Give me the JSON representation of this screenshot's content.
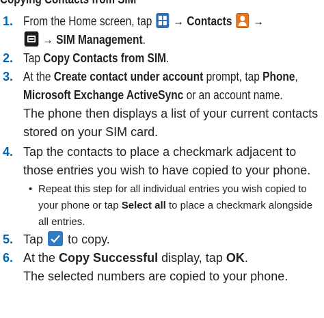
{
  "heading": "Copying Contacts from SIM",
  "steps": {
    "s1": {
      "num": "1.",
      "a": "From the Home screen, tap",
      "arrow1": "→",
      "contacts": "Contacts",
      "arrow2": "→",
      "arrow3": "→",
      "sim": "SIM Management",
      "end": "."
    },
    "s2": {
      "num": "2.",
      "a": "Tap",
      "b": "Copy Contacts from SIM",
      "end": "."
    },
    "s3": {
      "num": "3.",
      "a": "At the",
      "b": "Create contact under account",
      "c": "prompt, tap",
      "d": "Phone",
      "e": ",",
      "f": "Microsoft Exchange ActiveSync",
      "g": "or an account name."
    },
    "s3note": "The phone then displays a list of your current contacts stored on your SIM card.",
    "s4": {
      "num": "4.",
      "a": "Tap the contacts to place a checkmark adjacent to those entries you wish to have copied to your phone."
    },
    "s4bullet": {
      "dot": "•",
      "a": "Repeat this step for all individual entries you wish copied to your phone or tap",
      "b": "Select all",
      "c": "to place a checkmark alongside all entries."
    },
    "s5": {
      "num": "5.",
      "a": "Tap",
      "b": "to copy."
    },
    "s6": {
      "num": "6.",
      "a": "At the",
      "b": "Copy Successful",
      "c": "display, tap",
      "d": "OK",
      "end": "."
    },
    "s6note": "The selected numbers are copied to your phone."
  },
  "icons": [
    "apps-icon",
    "contacts-icon",
    "menu-icon",
    "checkmark-icon"
  ],
  "colors": {
    "step_number": "#0066b3",
    "apps_icon": "#2e6fb8",
    "contacts_icon": "#e4761f",
    "check_icon": "#2e7bc4"
  }
}
